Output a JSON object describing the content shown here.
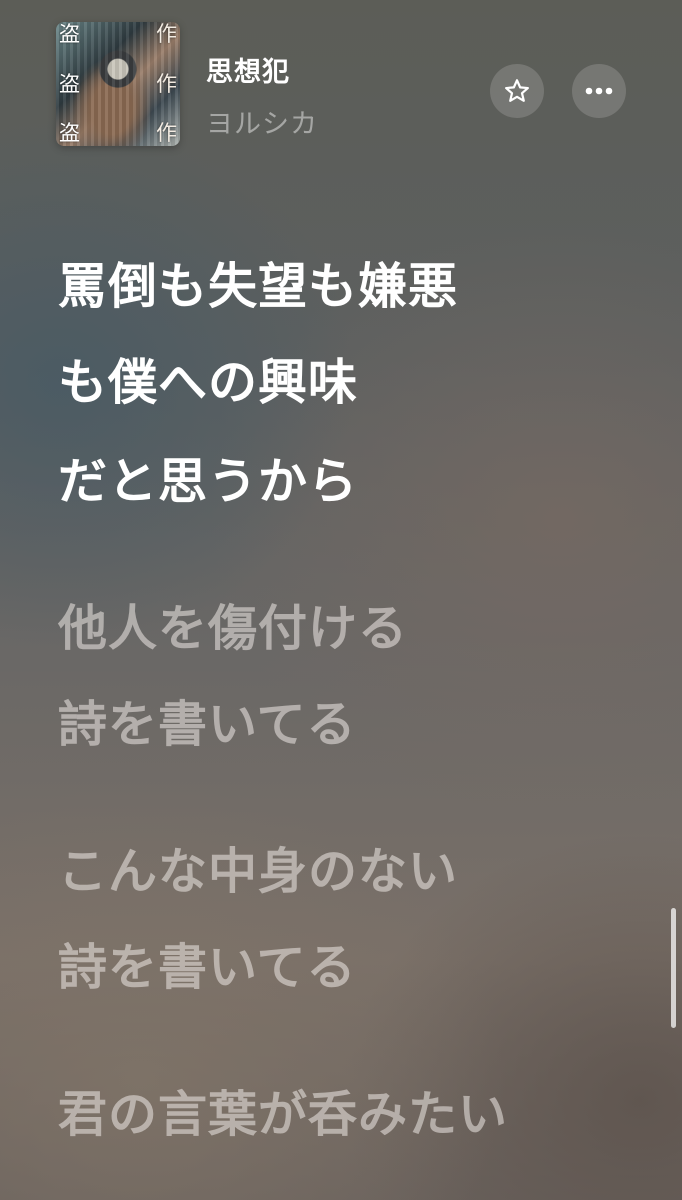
{
  "now_playing": {
    "title": "思想犯",
    "artist": "ヨルシカ",
    "artwork": {
      "left_glyphs": [
        "盗",
        "盗",
        "盗"
      ],
      "right_glyphs": [
        "作",
        "作",
        "作"
      ]
    }
  },
  "actions": {
    "favorite_icon": "star-outline-icon",
    "more_icon": "ellipsis-icon"
  },
  "lyrics": {
    "active": [
      "罵倒も失望も嫌悪",
      "も僕への興味",
      "だと思うから"
    ],
    "upcoming": [
      "他人を傷付ける",
      "詩を書いてる",
      "こんな中身のない",
      "詩を書いてる",
      "君の言葉が呑みたい"
    ]
  },
  "colors": {
    "active_lyric": "#ffffff",
    "dim_lyric": "rgba(236,230,226,0.56)",
    "artist_text": "rgba(210,212,210,0.62)"
  }
}
